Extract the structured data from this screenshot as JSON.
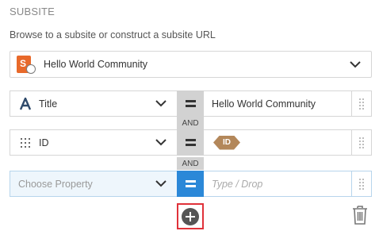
{
  "section": {
    "title": "SUBSITE",
    "description": "Browse to a subsite or construct a subsite URL"
  },
  "subsite_select": {
    "icon": "sharepoint-site-icon",
    "value": "Hello World Community"
  },
  "conditions": [
    {
      "property_icon": "text-field-icon",
      "property": "Title",
      "operator_icon": "equals-icon",
      "value": "Hello World Community"
    },
    {
      "property_icon": "grid-field-icon",
      "property": "ID",
      "operator_icon": "equals-icon",
      "value_token": "ID"
    },
    {
      "property": "",
      "property_placeholder": "Choose Property",
      "operator_icon": "equals-icon",
      "value": "",
      "value_placeholder": "Type / Drop"
    }
  ],
  "connectors": [
    "AND",
    "AND"
  ],
  "actions": {
    "add_icon": "plus-circle-icon",
    "delete_icon": "trash-icon"
  },
  "colors": {
    "accent": "#2b88d8",
    "operator_bg": "#d2d2d2",
    "highlight": "#e0323a",
    "token": "#b3875a",
    "site_icon": "#e8692a"
  }
}
